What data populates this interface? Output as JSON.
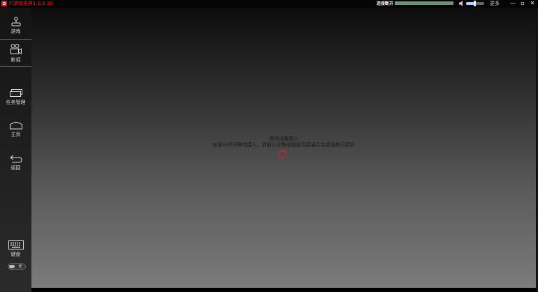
{
  "titlebar": {
    "app_title": "爪游戏投屏1.0.0.30",
    "connection_label": "连接断开",
    "connection_level": 1.0,
    "volume_level": 0.45,
    "more_label": "更多",
    "minimize": "—",
    "restore": "▫",
    "close": "✕"
  },
  "sidebar": {
    "items": [
      {
        "label": "游戏"
      },
      {
        "label": "影视"
      },
      {
        "label": "任务管理"
      },
      {
        "label": "主页"
      },
      {
        "label": "返回"
      },
      {
        "label": "键盘"
      }
    ],
    "keyboard_toggle_label": "关"
  },
  "main": {
    "status_title": "等待设备接入",
    "status_message": "如果长时间等待接入，请确认设备电源是否接通且连接线都已接好"
  },
  "colors": {
    "accent_red": "#e22424",
    "connection_green": "#3ab34a"
  }
}
